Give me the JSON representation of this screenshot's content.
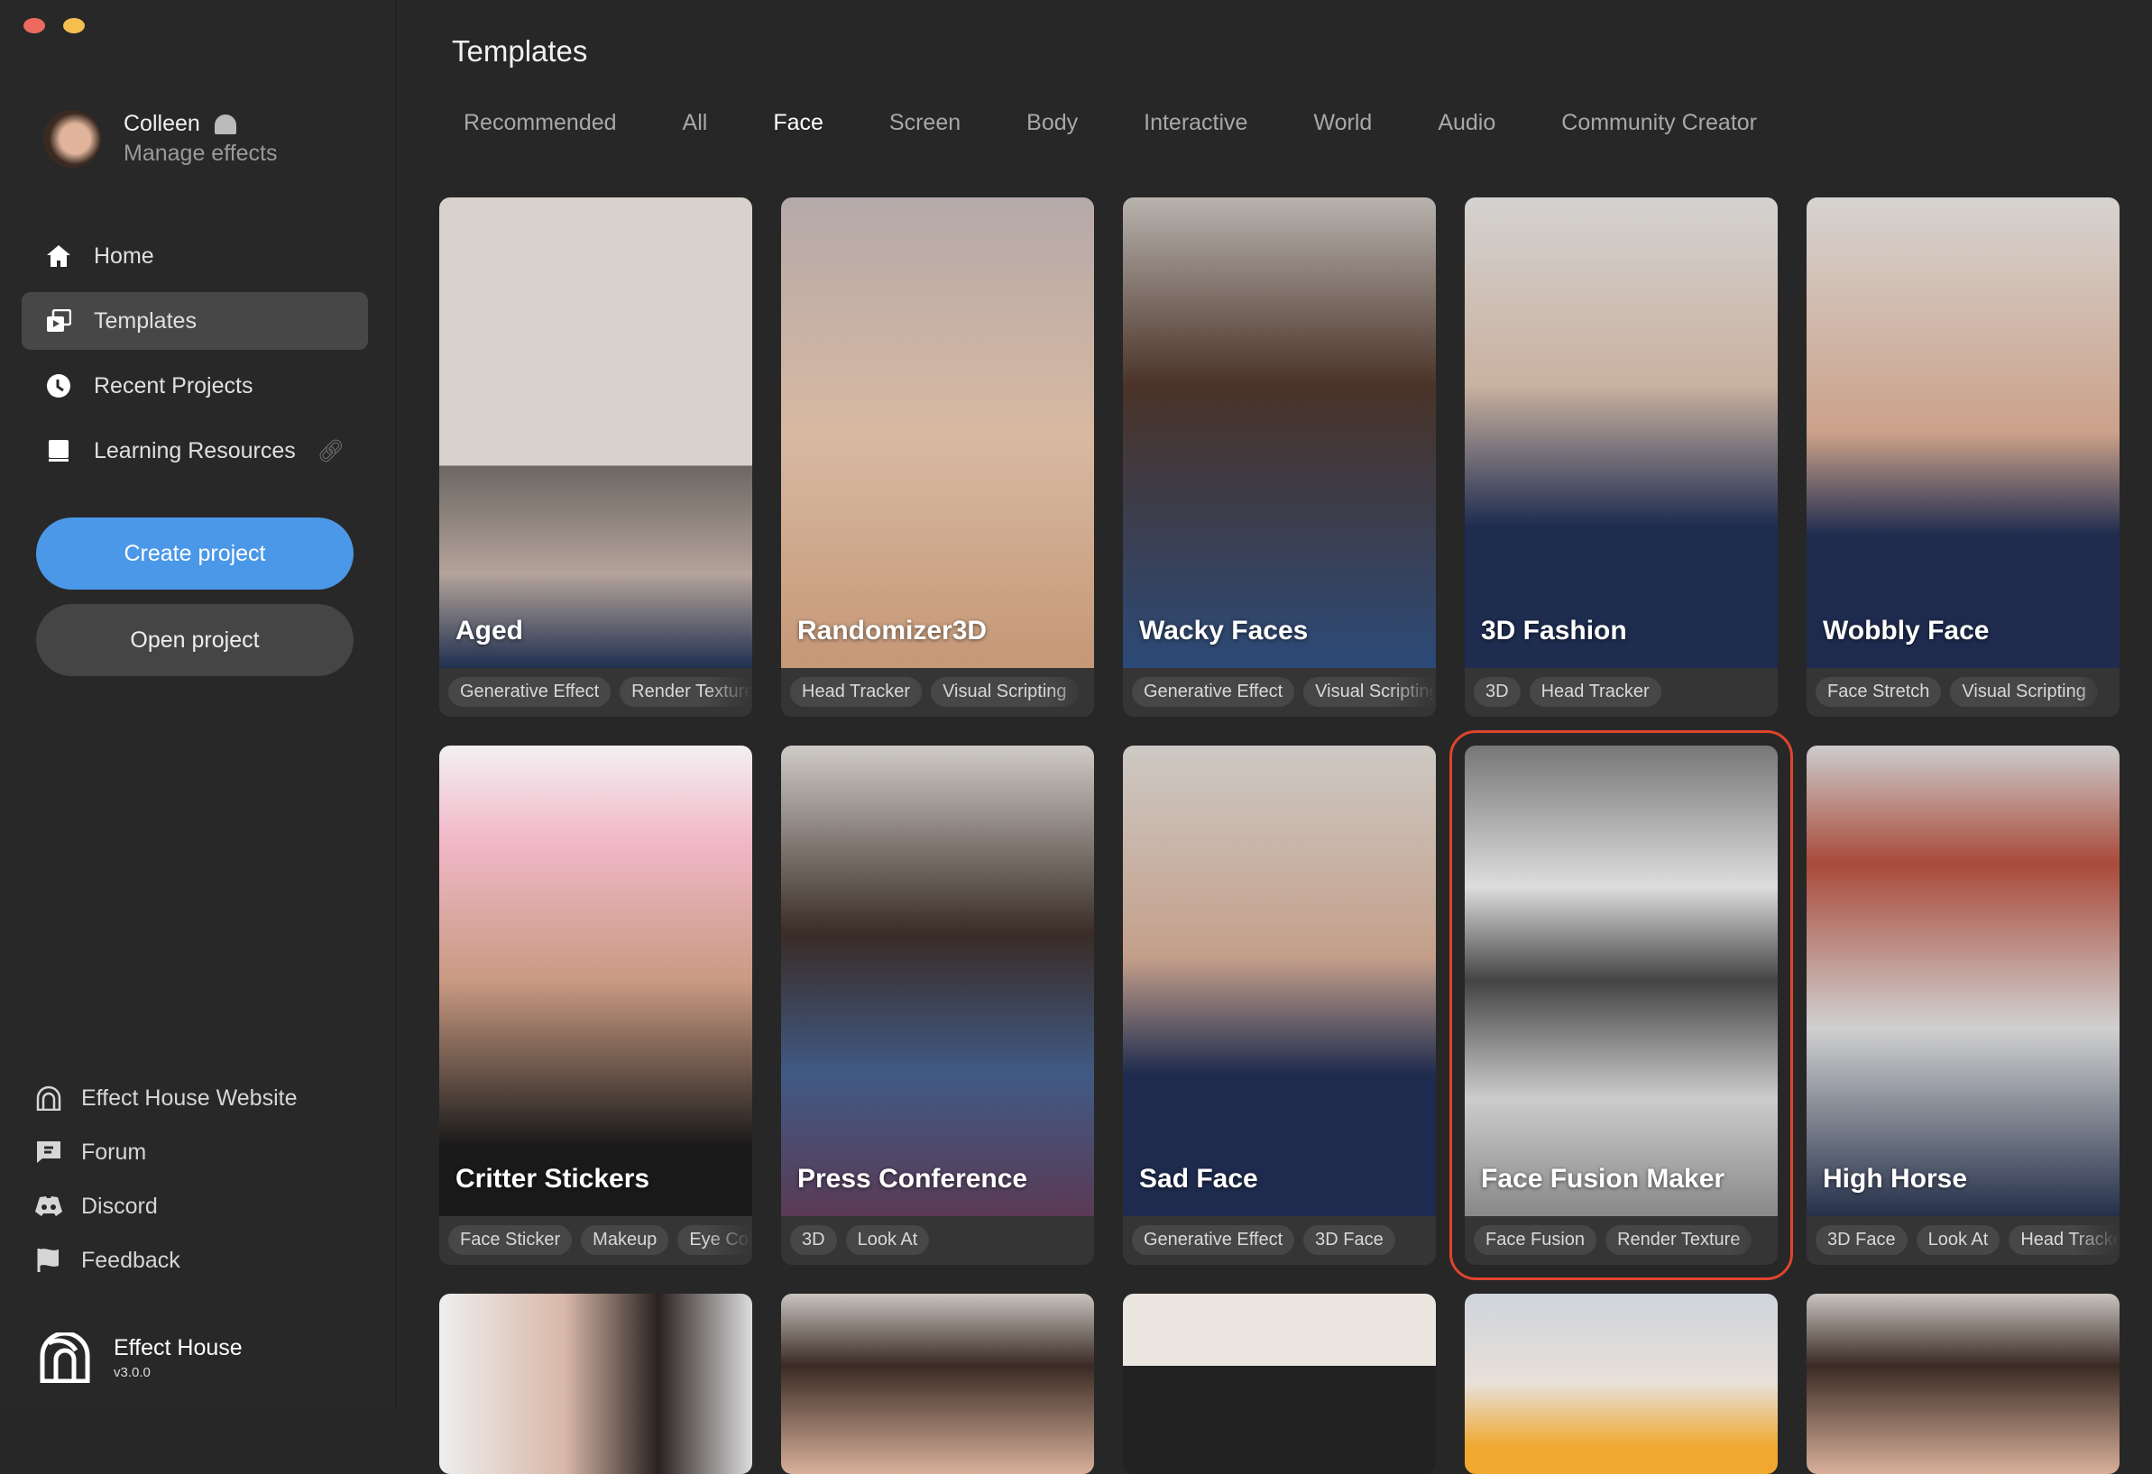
{
  "window": {
    "close_color": "#ec6a5e",
    "minimize_color": "#f4bf4f"
  },
  "user": {
    "name": "Colleen",
    "subtitle": "Manage effects"
  },
  "nav": [
    {
      "label": "Home",
      "icon": "home-icon"
    },
    {
      "label": "Templates",
      "icon": "templates-icon",
      "active": true
    },
    {
      "label": "Recent Projects",
      "icon": "clock-icon"
    },
    {
      "label": "Learning Resources",
      "icon": "book-icon",
      "external": true
    }
  ],
  "buttons": {
    "create": "Create project",
    "open": "Open project"
  },
  "footer": [
    {
      "label": "Effect House Website",
      "icon": "effect-house-icon"
    },
    {
      "label": "Forum",
      "icon": "forum-icon"
    },
    {
      "label": "Discord",
      "icon": "discord-icon"
    },
    {
      "label": "Feedback",
      "icon": "flag-icon"
    }
  ],
  "brand": {
    "name": "Effect House",
    "version": "v3.0.0"
  },
  "page": {
    "title": "Templates"
  },
  "tabs": [
    "Recommended",
    "All",
    "Face",
    "Screen",
    "Body",
    "Interactive",
    "World",
    "Audio",
    "Community Creator"
  ],
  "active_tab": "Face",
  "accent": "#4b98e8",
  "selection_color": "#e0442c",
  "cards": [
    {
      "title": "Aged",
      "tags": [
        "Generative Effect",
        "Render Texture"
      ]
    },
    {
      "title": "Randomizer3D",
      "tags": [
        "Head Tracker",
        "Visual Scripting"
      ]
    },
    {
      "title": "Wacky Faces",
      "tags": [
        "Generative Effect",
        "Visual Scripting"
      ]
    },
    {
      "title": "3D Fashion",
      "tags": [
        "3D",
        "Head Tracker"
      ]
    },
    {
      "title": "Wobbly Face",
      "tags": [
        "Face Stretch",
        "Visual Scripting"
      ]
    },
    {
      "title": "Critter Stickers",
      "tags": [
        "Face Sticker",
        "Makeup",
        "Eye Color"
      ]
    },
    {
      "title": "Press Conference",
      "tags": [
        "3D",
        "Look At"
      ]
    },
    {
      "title": "Sad Face",
      "tags": [
        "Generative Effect",
        "3D Face"
      ]
    },
    {
      "title": "Face Fusion Maker",
      "tags": [
        "Face Fusion",
        "Render Texture"
      ],
      "selected": true
    },
    {
      "title": "High Horse",
      "tags": [
        "3D Face",
        "Look At",
        "Head Tracker"
      ]
    }
  ]
}
